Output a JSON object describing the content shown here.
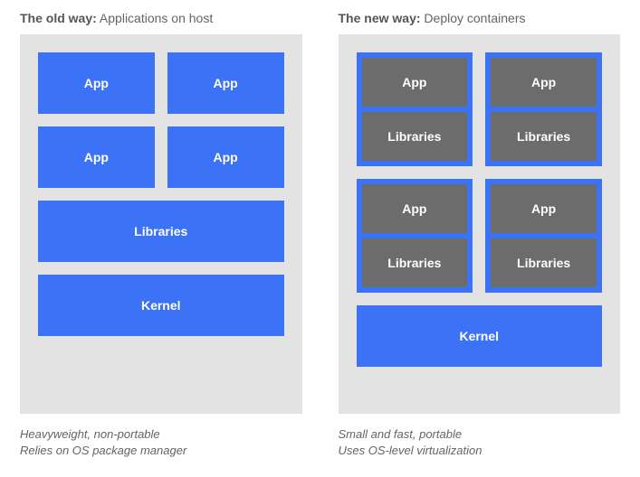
{
  "old": {
    "title_bold": "The old way:",
    "title_rest": "Applications on host",
    "apps": [
      "App",
      "App",
      "App",
      "App"
    ],
    "libraries": "Libraries",
    "kernel": "Kernel",
    "footer_l1": "Heavyweight, non-portable",
    "footer_l2": "Relies on OS package manager"
  },
  "new": {
    "title_bold": "The new way:",
    "title_rest": "Deploy containers",
    "containers": [
      {
        "app": "App",
        "libs": "Libraries"
      },
      {
        "app": "App",
        "libs": "Libraries"
      },
      {
        "app": "App",
        "libs": "Libraries"
      },
      {
        "app": "App",
        "libs": "Libraries"
      }
    ],
    "kernel": "Kernel",
    "footer_l1": "Small and fast, portable",
    "footer_l2": "Uses OS-level virtualization"
  }
}
